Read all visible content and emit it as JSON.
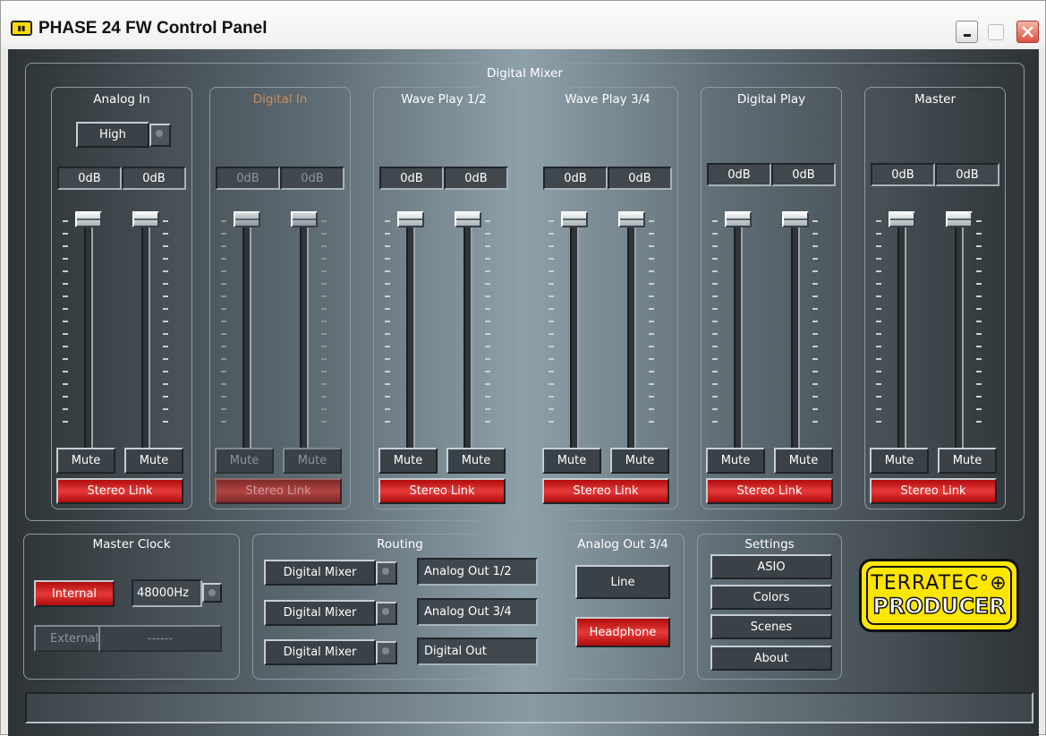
{
  "window": {
    "title": "PHASE 24 FW Control Panel",
    "icon": "app-icon"
  },
  "mixer": {
    "title": "Digital Mixer",
    "channels": [
      {
        "name": "Analog In",
        "enabled": true,
        "gain": "High",
        "left_db": "0dB",
        "right_db": "0dB",
        "mute_left": "Mute",
        "mute_right": "Mute",
        "stereo_link": "Stereo Link"
      },
      {
        "name": "Digital In",
        "enabled": false,
        "left_db": "0dB",
        "right_db": "0dB",
        "mute_left": "Mute",
        "mute_right": "Mute",
        "stereo_link": "Stereo Link"
      },
      {
        "name": "Wave Play 1/2",
        "enabled": true,
        "left_db": "0dB",
        "right_db": "0dB",
        "mute_left": "Mute",
        "mute_right": "Mute",
        "stereo_link": "Stereo Link"
      },
      {
        "name": "Wave Play 3/4",
        "enabled": true,
        "left_db": "0dB",
        "right_db": "0dB",
        "mute_left": "Mute",
        "mute_right": "Mute",
        "stereo_link": "Stereo Link"
      },
      {
        "name": "Digital Play",
        "enabled": true,
        "left_db": "0dB",
        "right_db": "0dB",
        "mute_left": "Mute",
        "mute_right": "Mute",
        "stereo_link": "Stereo Link"
      },
      {
        "name": "Master",
        "enabled": true,
        "left_db": "0dB",
        "right_db": "0dB",
        "mute_left": "Mute",
        "mute_right": "Mute",
        "stereo_link": "Stereo Link"
      }
    ],
    "fader_level": 1.0
  },
  "master_clock": {
    "title": "Master Clock",
    "internal": "Internal",
    "external": "External",
    "rate": "48000Hz",
    "external_rate": "------"
  },
  "routing": {
    "title": "Routing",
    "rows": [
      {
        "source": "Digital Mixer",
        "destination": "Analog Out 1/2"
      },
      {
        "source": "Digital Mixer",
        "destination": "Analog Out 3/4"
      },
      {
        "source": "Digital Mixer",
        "destination": "Digital Out"
      }
    ]
  },
  "analog_out": {
    "title": "Analog Out 3/4",
    "line": "Line",
    "headphone": "Headphone"
  },
  "settings": {
    "title": "Settings",
    "asio": "ASIO",
    "colors": "Colors",
    "scenes": "Scenes",
    "about": "About"
  },
  "logo": {
    "line1": "TERRATEC",
    "line2": "PRODUCER"
  },
  "colors": {
    "accent_red": "#e02020",
    "panel": "#5e6c74",
    "logo_yellow": "#ffe600"
  }
}
